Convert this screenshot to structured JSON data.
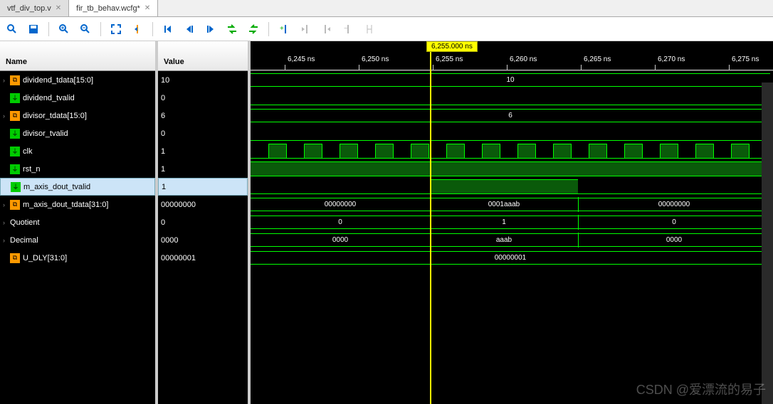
{
  "tabs": [
    {
      "label": "vtf_div_top.v",
      "active": false
    },
    {
      "label": "fir_tb_behav.wcfg*",
      "active": true
    }
  ],
  "headers": {
    "name": "Name",
    "value": "Value"
  },
  "marker": "6,255.000 ns",
  "ticks": [
    "6,245 ns",
    "6,250 ns",
    "6,255 ns",
    "6,260 ns",
    "6,265 ns",
    "6,270 ns",
    "6,275 ns"
  ],
  "signals": [
    {
      "name": "dividend_tdata[15:0]",
      "value": "10",
      "type": "bus",
      "expand": true,
      "selected": false,
      "wave": "bus",
      "segments": [
        {
          "label": "10",
          "l": 0,
          "r": 730
        }
      ]
    },
    {
      "name": "dividend_tvalid",
      "value": "0",
      "type": "wire",
      "expand": false,
      "selected": false,
      "wave": "line",
      "hi": false
    },
    {
      "name": "divisor_tdata[15:0]",
      "value": "6",
      "type": "bus",
      "expand": true,
      "selected": false,
      "wave": "bus",
      "segments": [
        {
          "label": "6",
          "l": 0,
          "r": 730
        }
      ]
    },
    {
      "name": "divisor_tvalid",
      "value": "0",
      "type": "wire",
      "expand": false,
      "selected": false,
      "wave": "line",
      "hi": false
    },
    {
      "name": "clk",
      "value": "1",
      "type": "wire",
      "expand": false,
      "selected": false,
      "wave": "clk"
    },
    {
      "name": "rst_n",
      "value": "1",
      "type": "wire",
      "expand": false,
      "selected": false,
      "wave": "fill",
      "segments": [
        {
          "l": 0,
          "r": 730
        }
      ]
    },
    {
      "name": "m_axis_dout_tvalid",
      "value": "1",
      "type": "wire",
      "expand": false,
      "selected": true,
      "wave": "fill",
      "segments": [
        {
          "l": 252,
          "r": 460
        }
      ]
    },
    {
      "name": "m_axis_dout_tdata[31:0]",
      "value": "00000000",
      "type": "bus",
      "expand": true,
      "selected": false,
      "wave": "bus",
      "segments": [
        {
          "label": "00000000",
          "l": 0,
          "r": 252
        },
        {
          "label": "0001aaab",
          "l": 252,
          "r": 460
        },
        {
          "label": "00000000",
          "l": 460,
          "r": 730
        }
      ]
    },
    {
      "name": "Quotient",
      "value": "0",
      "type": "none",
      "expand": true,
      "selected": false,
      "wave": "bus",
      "segments": [
        {
          "label": "0",
          "l": 0,
          "r": 252
        },
        {
          "label": "1",
          "l": 252,
          "r": 460
        },
        {
          "label": "0",
          "l": 460,
          "r": 730
        }
      ]
    },
    {
      "name": "Decimal",
      "value": "0000",
      "type": "none",
      "expand": true,
      "selected": false,
      "wave": "bus",
      "segments": [
        {
          "label": "0000",
          "l": 0,
          "r": 252
        },
        {
          "label": "aaab",
          "l": 252,
          "r": 460
        },
        {
          "label": "0000",
          "l": 460,
          "r": 730
        }
      ]
    },
    {
      "name": "U_DLY[31:0]",
      "value": "00000001",
      "type": "bus",
      "expand": false,
      "selected": false,
      "wave": "bus",
      "segments": [
        {
          "label": "00000001",
          "l": 0,
          "r": 730
        }
      ]
    }
  ],
  "clk_period": 50,
  "watermark": "CSDN @爱漂流的易子"
}
